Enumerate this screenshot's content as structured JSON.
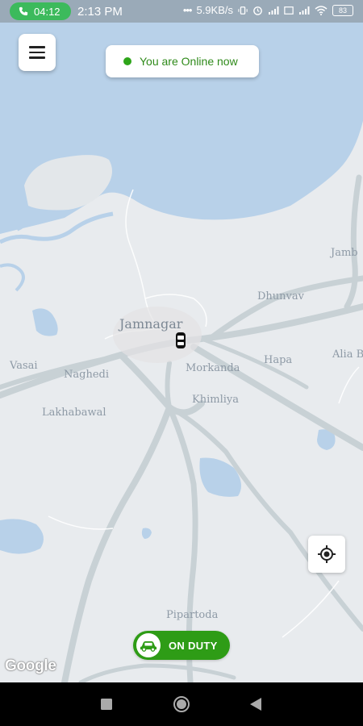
{
  "status_bar": {
    "call_timer": "04:12",
    "time": "2:13 PM",
    "network_speed": "5.9KB/s",
    "battery": "83"
  },
  "map": {
    "places": {
      "jamnagar": "Jamnagar",
      "dhunvav": "Dhunvav",
      "jamb": "Jamb",
      "vasai": "Vasai",
      "naghedi": "Naghedi",
      "morkanda": "Morkanda",
      "hapa": "Hapa",
      "alia_b": "Alia B",
      "khimliya": "Khimliya",
      "lakhabawal": "Lakhabawal",
      "pipartoda": "Pipartoda"
    },
    "colors": {
      "water": "#b7d0e8",
      "land": "#e8ebee",
      "road": "#c6d0d4"
    },
    "attribution": "Google"
  },
  "header": {
    "menu_icon": "hamburger-menu-icon",
    "status_text": "You are Online now",
    "status_color": "#2ea51a"
  },
  "controls": {
    "locate_icon": "my-location-icon",
    "duty_label": "ON DUTY",
    "duty_icon": "car-icon",
    "duty_color": "#2e9c16"
  },
  "nav_bar": {
    "recent_icon": "square-icon",
    "home_icon": "circle-icon",
    "back_icon": "triangle-back-icon"
  }
}
